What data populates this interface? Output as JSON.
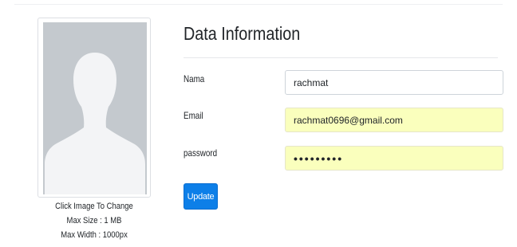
{
  "avatar": {
    "captions": [
      "Click Image To Change",
      "Max Size : 1 MB",
      "Max Width : 1000px"
    ]
  },
  "form": {
    "title": "Data Information",
    "fields": [
      {
        "label": "Nama",
        "value": "rachmat"
      },
      {
        "label": "Email",
        "value": "rachmat0696@gmail.com"
      },
      {
        "label": "password",
        "value": "rachmat12"
      }
    ],
    "button_label": "Update"
  },
  "colors": {
    "primary": "#0d7fe8",
    "autofill_bg": "#faffbd",
    "placeholder_avatar_bg": "#c4c9ce"
  }
}
